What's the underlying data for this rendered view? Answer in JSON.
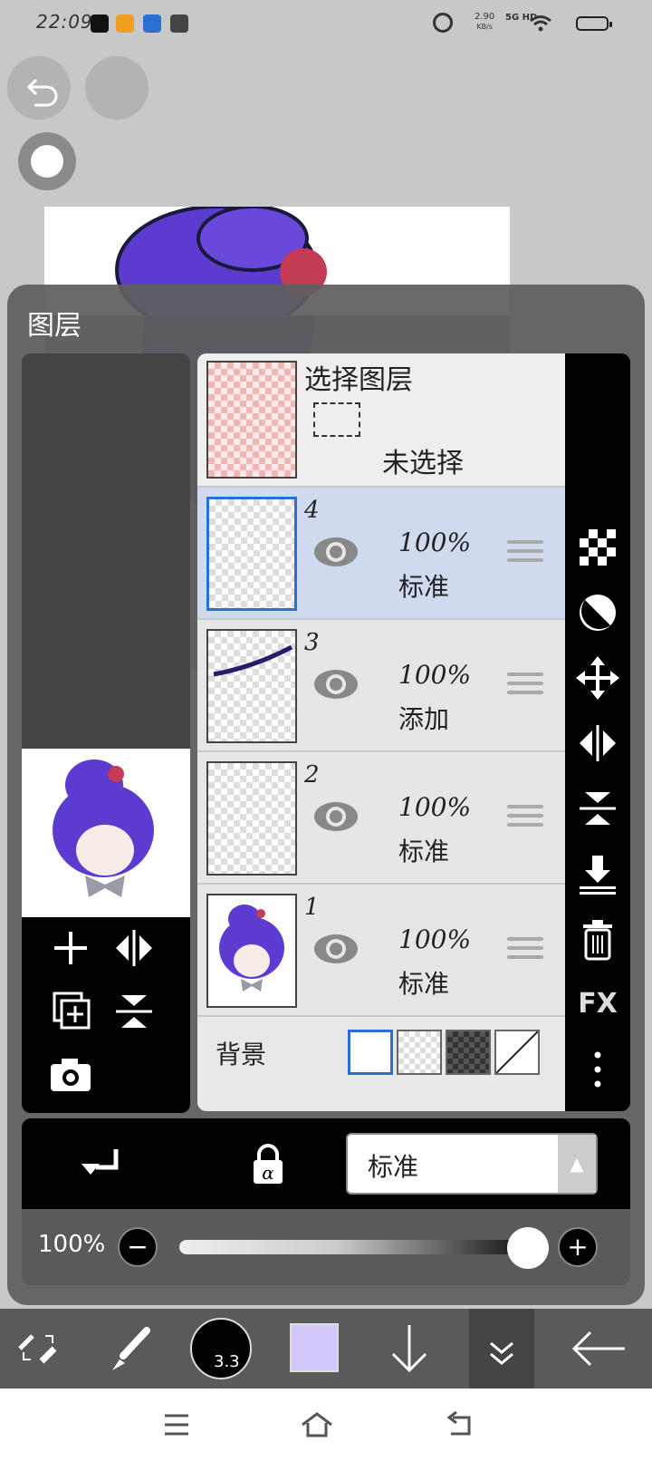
{
  "status_bar": {
    "time": "22:09",
    "net_speed": "2.90",
    "net_unit": "KB/s",
    "signal_label": "5G HD"
  },
  "layers_panel": {
    "title": "图层",
    "selection_layer": {
      "title": "选择图层",
      "status": "未选择"
    },
    "layers": [
      {
        "num": "4",
        "opacity": "100%",
        "mode": "标准",
        "selected": true
      },
      {
        "num": "3",
        "opacity": "100%",
        "mode": "添加",
        "selected": false
      },
      {
        "num": "2",
        "opacity": "100%",
        "mode": "标准",
        "selected": false
      },
      {
        "num": "1",
        "opacity": "100%",
        "mode": "标准",
        "selected": false
      }
    ],
    "background_label": "背景",
    "blend_mode": "标准",
    "opacity_value": "100%",
    "opacity_fraction": 1.0,
    "right_tools": [
      "checker-icon",
      "half-circle-icon",
      "move-icon",
      "flip-horizontal-icon",
      "flip-vertical-icon",
      "merge-down-icon",
      "trash-icon",
      "fx-label",
      "more-icon"
    ],
    "fx_label": "FX"
  },
  "toolbar": {
    "brush_size": "3.3",
    "color": "#d4c7fb"
  },
  "colors": {
    "selected_layer_bg": "#cfdaee",
    "selected_border": "#2a6fd1",
    "hair_purple": "#5b3bd0"
  }
}
